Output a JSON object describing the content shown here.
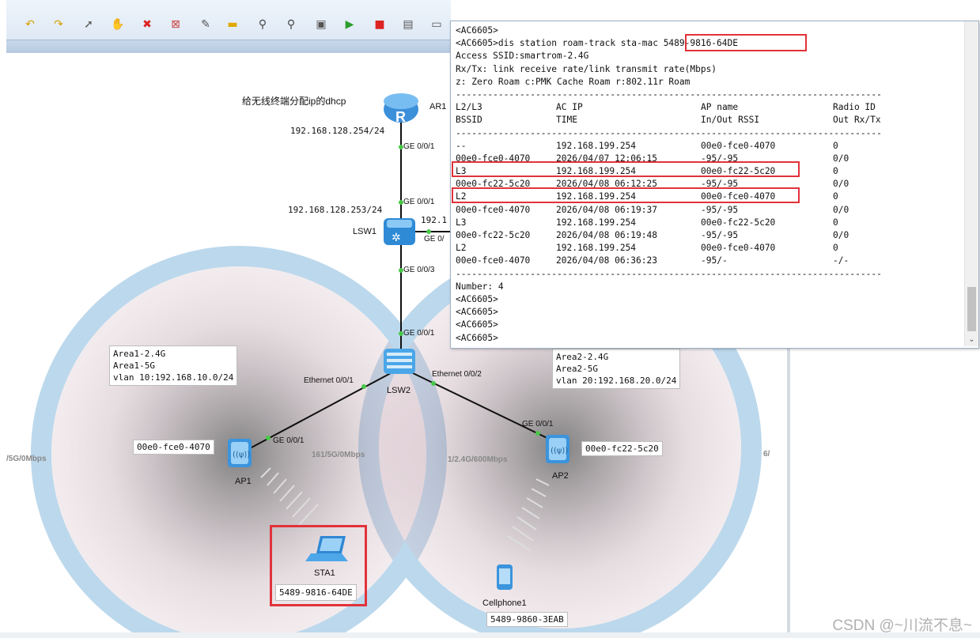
{
  "toolbar": {
    "icons": [
      "undo-icon",
      "redo-icon",
      "pointer-icon",
      "hand-icon",
      "delete-icon",
      "delete-all-icon",
      "text-icon",
      "rectangle-icon",
      "zoom-icon",
      "zoom-fit-icon",
      "palette-icon",
      "start-icon",
      "stop-icon",
      "capture-icon",
      "cli-icon"
    ]
  },
  "topology": {
    "dhcp_note": "给无线终端分配ip的dhcp",
    "ar1": {
      "name": "AR1",
      "ip": "192.168.128.254/24",
      "port": "GE 0/0/1"
    },
    "lsw1": {
      "name": "LSW1",
      "ip": "192.168.128.253/24",
      "port_up": "GE 0/0/1",
      "port_down": "GE 0/0/3",
      "port_right": "GE 0/",
      "ip_right": "192.1"
    },
    "lsw2": {
      "name": "LSW2",
      "port_up": "GE 0/0/1",
      "port_left": "Ethernet 0/0/1",
      "port_right": "Ethernet 0/0/2"
    },
    "area1": {
      "line1": "Area1-2.4G",
      "line2": "Area1-5G",
      "line3": "vlan 10:192.168.10.0/24"
    },
    "area2": {
      "line1": "Area2-2.4G",
      "line2": "Area2-5G",
      "line3": "vlan 20:192.168.20.0/24"
    },
    "ap1": {
      "name": "AP1",
      "mac": "00e0-fce0-4070",
      "port": "GE 0/0/1",
      "rate_left": "/5G/0Mbps",
      "rate_right": "161/5G/0Mbps"
    },
    "ap2": {
      "name": "AP2",
      "mac": "00e0-fc22-5c20",
      "port": "GE 0/0/1",
      "rate_left": "1/2.4G/600Mbps",
      "rate_right": "6/"
    },
    "sta1": {
      "name": "STA1",
      "mac": "5489-9816-64DE"
    },
    "cellphone1": {
      "name": "Cellphone1",
      "mac": "5489-9860-3EAB"
    }
  },
  "terminal": {
    "prompt_top": "<AC6605>",
    "command_prefix": "<AC6605>dis station roam-track sta-mac ",
    "command_mac": "5489-9816-64DE",
    "ssid_line": "Access SSID:smartrom-2.4G",
    "rxtx_line": "Rx/Tx: link receive rate/link transmit rate(Mbps)",
    "legend_line": "z: Zero Roam c:PMK Cache Roam r:802.11r Roam",
    "divider": "--------------------------------------------------------------------------------",
    "headers": [
      [
        "L2/L3",
        "AC IP",
        "AP name",
        "Radio ID"
      ],
      [
        "BSSID",
        "TIME",
        "In/Out RSSI",
        "Out Rx/Tx"
      ]
    ],
    "rows": [
      [
        "--",
        "192.168.199.254",
        "00e0-fce0-4070",
        "0"
      ],
      [
        "00e0-fce0-4070",
        "2026/04/07 12:06:15",
        "-95/-95",
        "0/0"
      ],
      [
        "L3",
        "192.168.199.254",
        "00e0-fc22-5c20",
        "0"
      ],
      [
        "00e0-fc22-5c20",
        "2026/04/08 06:12:25",
        "-95/-95",
        "0/0"
      ],
      [
        "L2",
        "192.168.199.254",
        "00e0-fce0-4070",
        "0"
      ],
      [
        "00e0-fce0-4070",
        "2026/04/08 06:19:37",
        "-95/-95",
        "0/0"
      ],
      [
        "L3",
        "192.168.199.254",
        "00e0-fc22-5c20",
        "0"
      ],
      [
        "00e0-fc22-5c20",
        "2026/04/08 06:19:48",
        "-95/-95",
        "0/0"
      ],
      [
        "L2",
        "192.168.199.254",
        "00e0-fce0-4070",
        "0"
      ],
      [
        "00e0-fce0-4070",
        "2026/04/08 06:36:23",
        "-95/-",
        "-/-"
      ]
    ],
    "number_line": "Number: 4",
    "trailing_prompts": [
      "<AC6605>",
      "<AC6605>",
      "<AC6605>",
      "<AC6605>"
    ]
  },
  "watermark": "CSDN @~川流不息~"
}
